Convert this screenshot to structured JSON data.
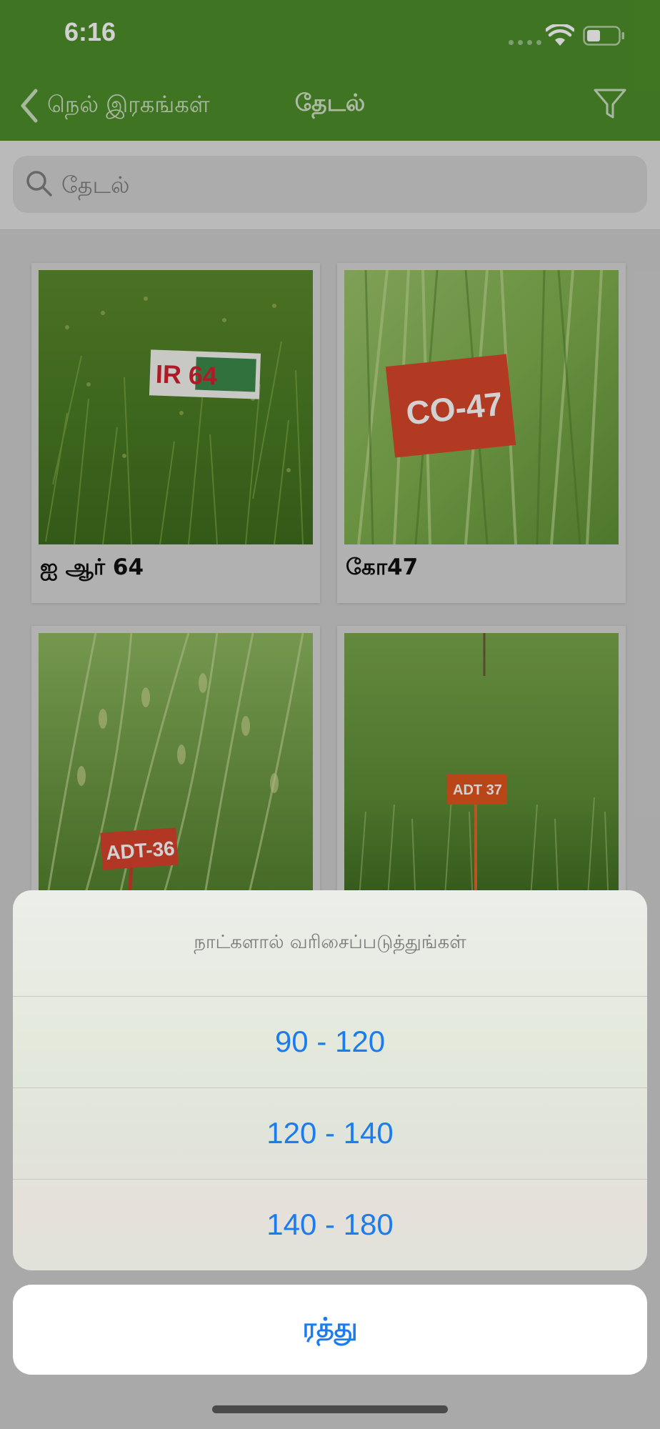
{
  "status_bar": {
    "time": "6:16"
  },
  "nav": {
    "back_label": "நெல் இரகங்கள்",
    "title": "தேடல்"
  },
  "search": {
    "placeholder": "தேடல்",
    "value": ""
  },
  "varieties": [
    {
      "name": "ஐ ஆர் 64",
      "sign": "IR 64"
    },
    {
      "name": "கோ47",
      "sign": "CO-47"
    },
    {
      "name": "",
      "sign": "ADT-36"
    },
    {
      "name": "",
      "sign": "ADT 37"
    }
  ],
  "sort_sheet": {
    "title": "நாட்களால் வரிசைப்படுத்துங்கள்",
    "options": [
      "90 - 120",
      "120 - 140",
      "140 - 180"
    ],
    "cancel": "ரத்து"
  },
  "icons": {
    "back": "chevron-left-icon",
    "filter": "filter-funnel-icon",
    "search": "magnifier-icon",
    "wifi": "wifi-icon",
    "battery": "battery-icon"
  },
  "colors": {
    "header": "#4e8f2a",
    "accent": "#1a7cf0"
  }
}
